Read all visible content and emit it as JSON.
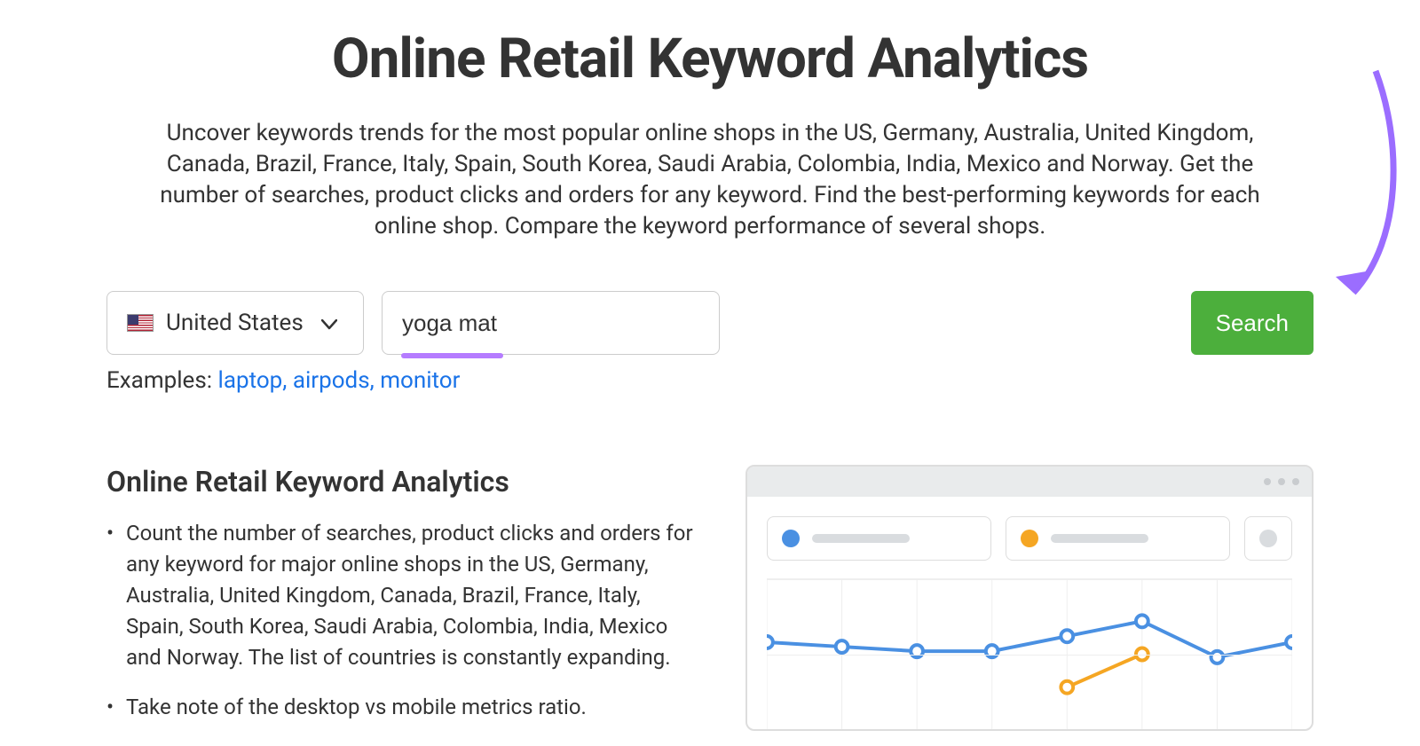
{
  "header": {
    "title": "Online Retail Keyword Analytics",
    "subtitle": "Uncover keywords trends for the most popular online shops in the US, Germany, Australia, United Kingdom, Canada, Brazil, France, Italy, Spain, South Korea, Saudi Arabia, Colombia, India, Mexico and Norway. Get the number of searches, product clicks and orders for any keyword. Find the best-performing keywords for each online shop. Compare the keyword performance of several shops."
  },
  "search": {
    "country": "United States",
    "input_value": "yoga mat",
    "button_label": "Search"
  },
  "examples": {
    "label": "Examples:",
    "items": [
      "laptop",
      "airpods",
      "monitor"
    ]
  },
  "info": {
    "heading": "Online Retail Keyword Analytics",
    "bullets": [
      "Count the number of searches, product clicks and orders for any keyword for major online shops in the US, Germany, Australia, United Kingdom, Canada, Brazil, France, Italy, Spain, South Korea, Saudi Arabia, Colombia, India, Mexico and Norway. The list of countries is constantly expanding.",
      "Take note of the desktop vs mobile metrics ratio."
    ]
  },
  "colors": {
    "accent_green": "#4caf3c",
    "link_blue": "#1a73e8",
    "highlight_purple": "#b57cff",
    "series_blue": "#4a90e2",
    "series_orange": "#f5a623"
  },
  "chart_data": {
    "type": "line",
    "x": [
      0,
      1,
      2,
      3,
      4,
      5,
      6,
      7
    ],
    "series": [
      {
        "name": "blue",
        "color": "#4a90e2",
        "values": [
          58,
          55,
          52,
          52,
          62,
          72,
          48,
          58
        ]
      },
      {
        "name": "orange",
        "color": "#f5a623",
        "values": [
          null,
          null,
          null,
          null,
          28,
          50,
          null,
          null
        ]
      }
    ],
    "ylim": [
      0,
      100
    ]
  }
}
